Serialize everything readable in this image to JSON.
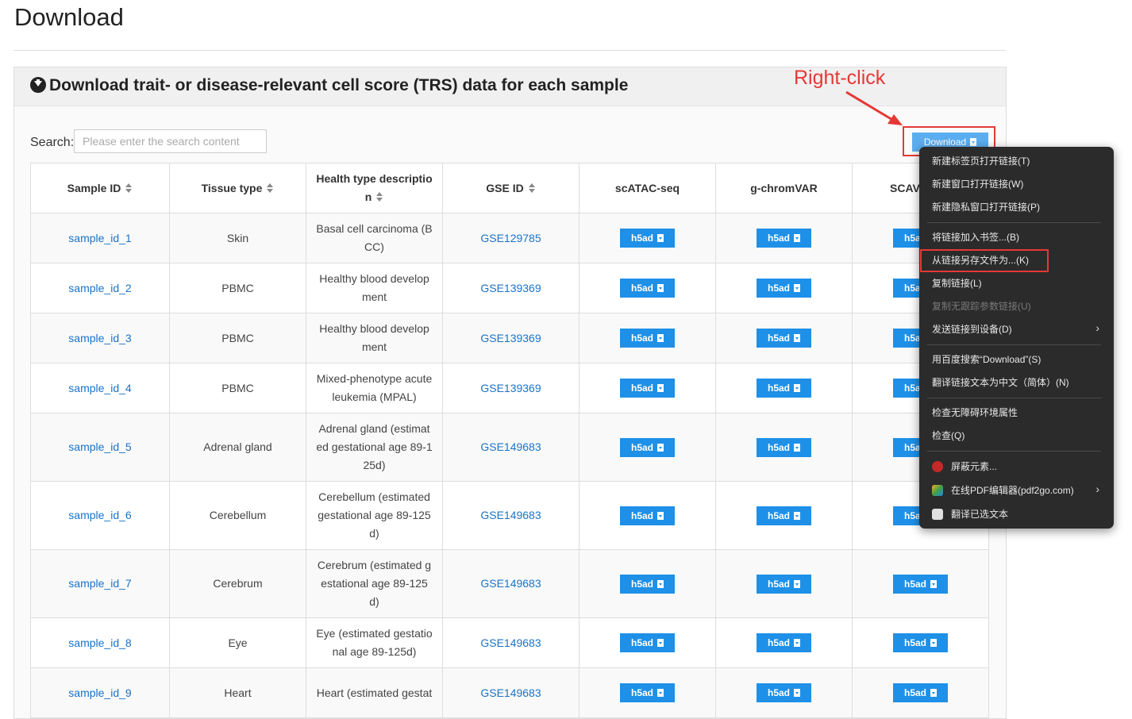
{
  "page": {
    "title": "Download"
  },
  "panel": {
    "title": "Download trait- or disease-relevant cell score (TRS) data for each sample"
  },
  "search": {
    "label": "Search:",
    "placeholder": "Please enter the search content"
  },
  "download_button": {
    "label": "Download"
  },
  "annotation": {
    "text": "Right-click",
    "color": "#e53935"
  },
  "table": {
    "headers": [
      "Sample ID",
      "Tissue type",
      "Health type descriptio\nn",
      "GSE ID",
      "scATAC-seq",
      "g-chromVAR",
      "SCAV"
    ],
    "button_label": "h5ad",
    "rows": [
      {
        "sample": "sample_id_1",
        "tissue": "Skin",
        "health": "Basal cell carcinoma (B\nCC)",
        "gse": "GSE129785"
      },
      {
        "sample": "sample_id_2",
        "tissue": "PBMC",
        "health": "Healthy blood develop\nment",
        "gse": "GSE139369"
      },
      {
        "sample": "sample_id_3",
        "tissue": "PBMC",
        "health": "Healthy blood develop\nment",
        "gse": "GSE139369"
      },
      {
        "sample": "sample_id_4",
        "tissue": "PBMC",
        "health": "Mixed-phenotype acute\nleukemia (MPAL)",
        "gse": "GSE139369"
      },
      {
        "sample": "sample_id_5",
        "tissue": "Adrenal gland",
        "health": "Adrenal gland (estimat\ned gestational age 89-1\n25d)",
        "gse": "GSE149683"
      },
      {
        "sample": "sample_id_6",
        "tissue": "Cerebellum",
        "health": "Cerebellum (estimated\ngestational age 89-125\nd)",
        "gse": "GSE149683"
      },
      {
        "sample": "sample_id_7",
        "tissue": "Cerebrum",
        "health": "Cerebrum (estimated g\nestational age 89-125\nd)",
        "gse": "GSE149683"
      },
      {
        "sample": "sample_id_8",
        "tissue": "Eye",
        "health": "Eye (estimated gestatio\nnal age 89-125d)",
        "gse": "GSE149683"
      },
      {
        "sample": "sample_id_9",
        "tissue": "Heart",
        "health": "Heart (estimated gestat",
        "gse": "GSE149683"
      }
    ]
  },
  "context_menu": {
    "items": [
      {
        "label": "新建标签页打开链接(T)"
      },
      {
        "label": "新建窗口打开链接(W)"
      },
      {
        "label": "新建隐私窗口打开链接(P)"
      },
      {
        "label": "将链接加入书签...(B)"
      },
      {
        "label": "从链接另存文件为...(K)"
      },
      {
        "label": "复制链接(L)"
      },
      {
        "label": "复制无跟踪参数链接(U)"
      },
      {
        "label": "发送链接到设备(D)"
      },
      {
        "label": "用百度搜索“Download”(S)"
      },
      {
        "label": "翻译链接文本为中文（简体）(N)"
      },
      {
        "label": "检查无障碍环境属性"
      },
      {
        "label": "检查(Q)"
      },
      {
        "label": "屏蔽元素..."
      },
      {
        "label": "在线PDF编辑器(pdf2go.com)"
      },
      {
        "label": "翻译已选文本"
      }
    ]
  }
}
